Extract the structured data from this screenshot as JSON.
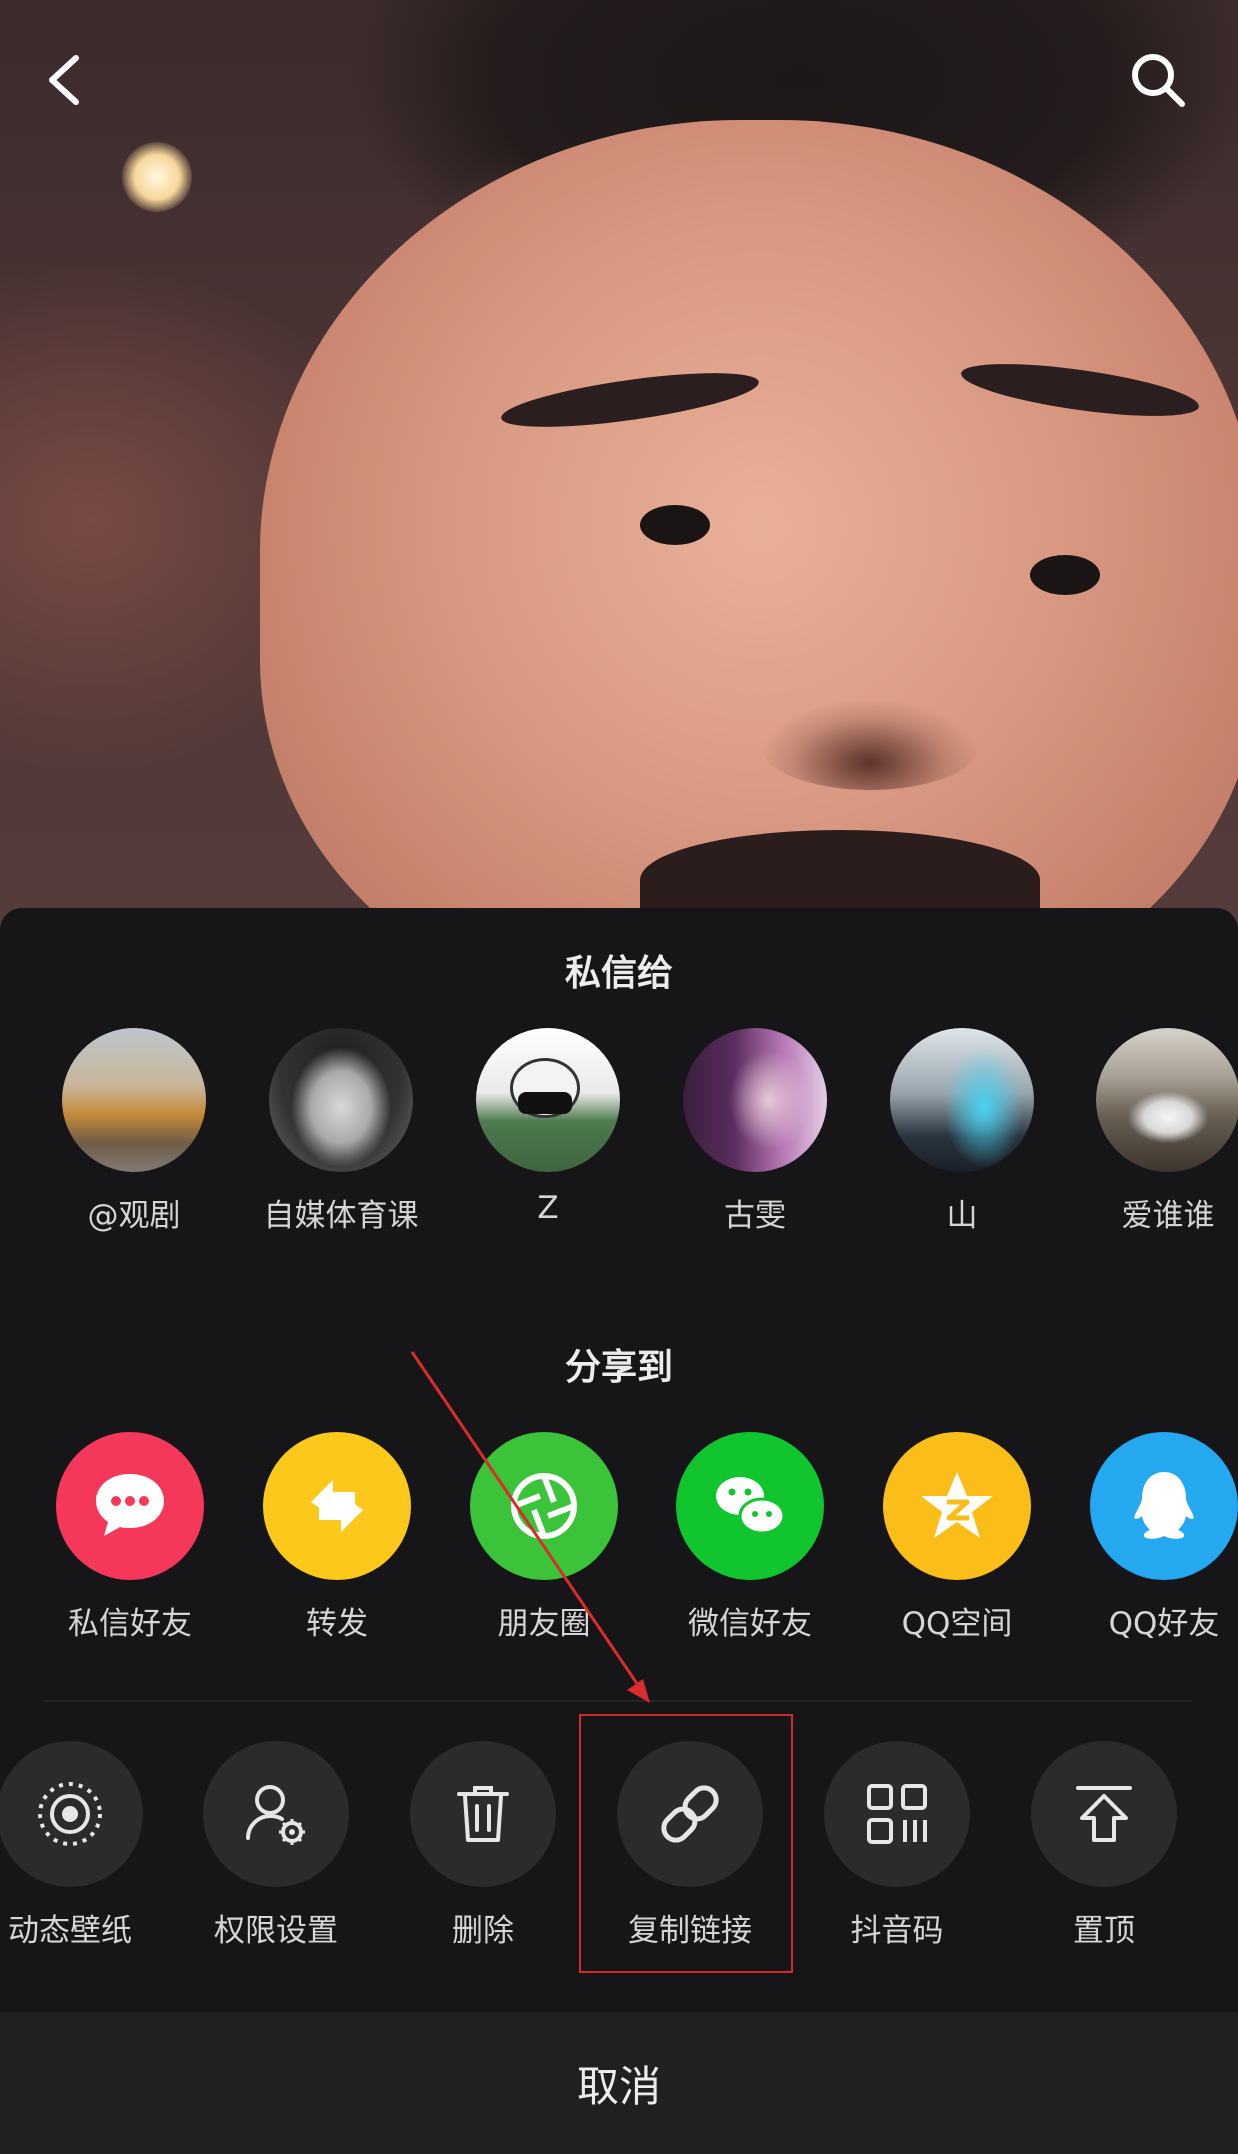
{
  "top_bar": {
    "back_icon": "chevron-left-icon",
    "search_icon": "search-icon"
  },
  "sheet": {
    "dm_title": "私信给",
    "contacts": [
      {
        "name": "@观剧"
      },
      {
        "name": "自媒体育课"
      },
      {
        "name": "Z"
      },
      {
        "name": "古雯"
      },
      {
        "name": "山"
      },
      {
        "name": "爱谁谁"
      }
    ],
    "share_title": "分享到",
    "share_targets": [
      {
        "label": "私信好友",
        "icon": "chat-bubble-icon",
        "color": "#f5385a"
      },
      {
        "label": "转发",
        "icon": "repost-icon",
        "color": "#fcc81c"
      },
      {
        "label": "朋友圈",
        "icon": "moments-shutter-icon",
        "color": "#3bc43a"
      },
      {
        "label": "微信好友",
        "icon": "wechat-icon",
        "color": "#10c52e"
      },
      {
        "label": "QQ空间",
        "icon": "qzone-star-icon",
        "color": "#fbbd17"
      },
      {
        "label": "QQ好友",
        "icon": "qq-penguin-icon",
        "color": "#24a8f0"
      }
    ],
    "actions": [
      {
        "label": "动态壁纸",
        "icon": "live-wallpaper-icon"
      },
      {
        "label": "权限设置",
        "icon": "user-settings-icon"
      },
      {
        "label": "删除",
        "icon": "trash-icon"
      },
      {
        "label": "复制链接",
        "icon": "link-icon"
      },
      {
        "label": "抖音码",
        "icon": "qr-code-icon"
      },
      {
        "label": "置顶",
        "icon": "pin-top-icon"
      }
    ],
    "cancel_label": "取消"
  },
  "colors": {
    "sheet_bg": "#161618",
    "action_circle": "#2b2b2e",
    "highlight_red": "#d02a2a"
  }
}
